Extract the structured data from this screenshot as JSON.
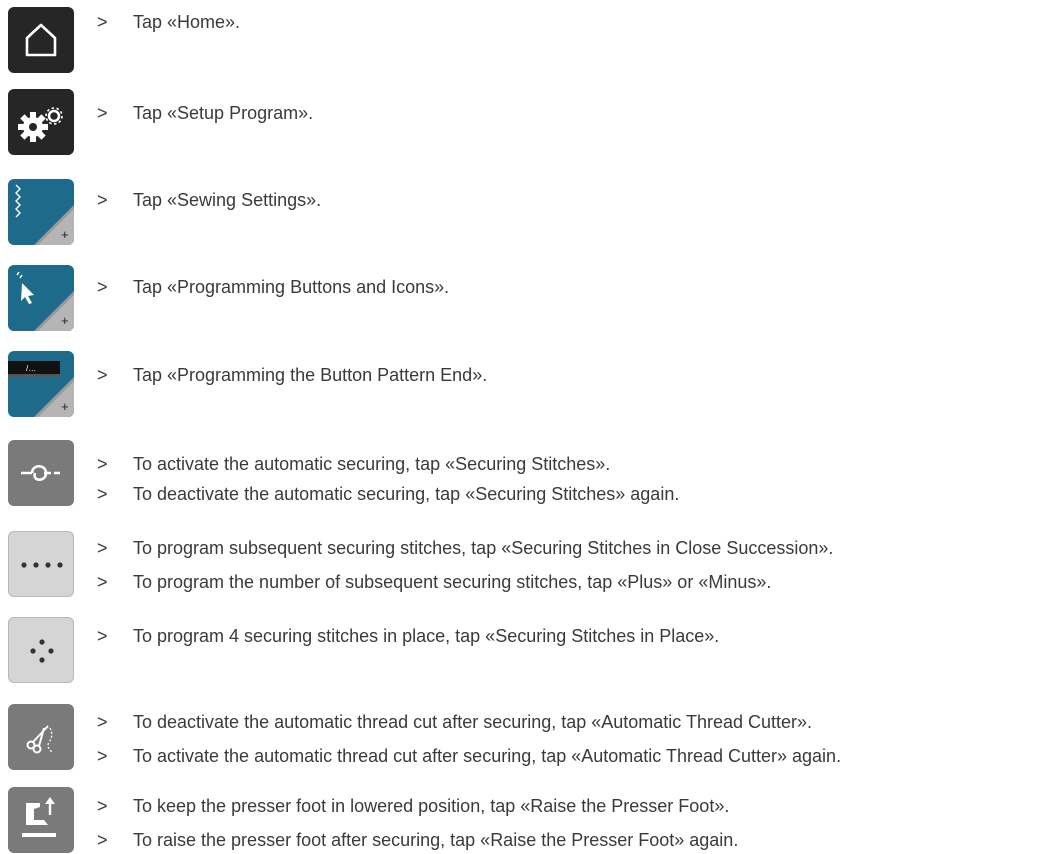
{
  "steps": [
    {
      "icon": "home-icon",
      "lines": [
        "Tap «Home»."
      ]
    },
    {
      "icon": "setup-program-icon",
      "lines": [
        "Tap «Setup Program»."
      ]
    },
    {
      "icon": "sewing-settings-icon",
      "lines": [
        "Tap «Sewing Settings»."
      ]
    },
    {
      "icon": "programming-buttons-icon",
      "lines": [
        "Tap «Programming Buttons and Icons»."
      ]
    },
    {
      "icon": "button-pattern-end-icon",
      "lines": [
        "Tap «Programming the Button Pattern End»."
      ]
    },
    {
      "icon": "securing-stitches-icon",
      "lines": [
        "To activate the automatic securing, tap «Securing Stitches».",
        "To deactivate the automatic securing, tap «Securing Stitches» again."
      ]
    },
    {
      "icon": "securing-close-succession-icon",
      "lines": [
        "To program subsequent securing stitches, tap «Securing Stitches in Close Succession».",
        "To program the number of subsequent securing stitches, tap «Plus» or «Minus»."
      ]
    },
    {
      "icon": "securing-in-place-icon",
      "lines": [
        "To program 4 securing stitches in place, tap «Securing Stitches in Place»."
      ]
    },
    {
      "icon": "thread-cutter-icon",
      "lines": [
        "To deactivate the automatic thread cut after securing, tap «Automatic Thread Cutter».",
        "To activate the automatic thread cut after securing, tap «Automatic Thread Cutter» again."
      ]
    },
    {
      "icon": "raise-presser-foot-icon",
      "lines": [
        "To keep the presser foot in lowered position, tap «Raise the Presser Foot».",
        "To raise the presser foot after securing, tap «Raise the Presser Foot» again."
      ]
    }
  ],
  "bullet": ">"
}
